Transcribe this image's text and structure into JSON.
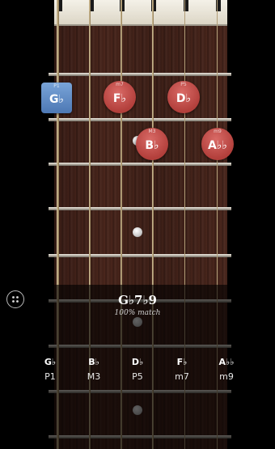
{
  "chord": {
    "name": "G♭7♭9",
    "match": "100% match"
  },
  "notes": [
    {
      "name": "G♭",
      "degree": "P1",
      "style": "blue"
    },
    {
      "name": "F♭",
      "degree": "m7",
      "style": "red"
    },
    {
      "name": "D♭",
      "degree": "P5",
      "style": "red"
    },
    {
      "name": "B♭",
      "degree": "M3",
      "style": "red"
    },
    {
      "name": "A♭♭",
      "degree": "m9",
      "style": "red"
    }
  ],
  "chord_tones": [
    {
      "name": "G♭",
      "interval": "P1"
    },
    {
      "name": "B♭",
      "interval": "M3"
    },
    {
      "name": "D♭",
      "interval": "P5"
    },
    {
      "name": "F♭",
      "interval": "m7"
    },
    {
      "name": "A♭♭",
      "interval": "m9"
    }
  ],
  "icons": {
    "menu": "grid-menu-icon"
  },
  "colors": {
    "root": "#5a85c2",
    "tone": "#c0504d"
  }
}
